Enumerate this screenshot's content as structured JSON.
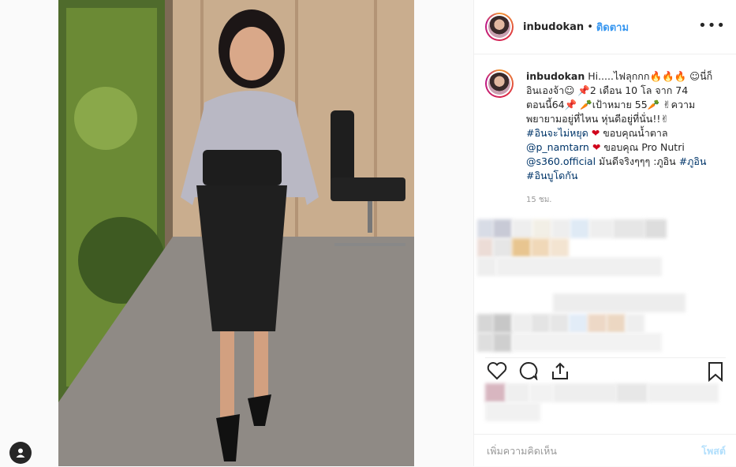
{
  "post": {
    "username": "inbudokan",
    "follow_label": "ติดตาม",
    "more_icon": "more-icon",
    "caption_user": "inbudokan",
    "caption_lines": [
      "Hi.....ไฟลุกกก🔥🔥🔥 ☺นี่ก็",
      "อินเองจ้า☺ 📌2 เดือน 10 โล จาก 74",
      "ตอนนี้64📌 🥕เป้าหมาย 55🥕 ✌ความ",
      "พยายามอยู่ที่ไหน หุ่นดีอยู่ที่นั่น!!✌"
    ],
    "hashtag_1": "#อินจะไม่หยุด",
    "thanks_1": "ขอบคุณน้ำตาล",
    "mention_1": "@p_namtarn",
    "thanks_2": "ขอบคุณ Pro Nutri",
    "mention_2": "@s360.official",
    "tail_text": "มันดีจริงๆๆๆ :ภูอิน",
    "hashtag_2": "#ภูอิน",
    "hashtag_3": "#อินบูโดกัน",
    "time": "15 ชม.",
    "comment_placeholder": "เพิ่มความคิดเห็น",
    "post_label": "โพสต์"
  },
  "colors": {
    "follow": "#3897f0",
    "link": "#003569",
    "post_disabled": "#b2dffc"
  }
}
